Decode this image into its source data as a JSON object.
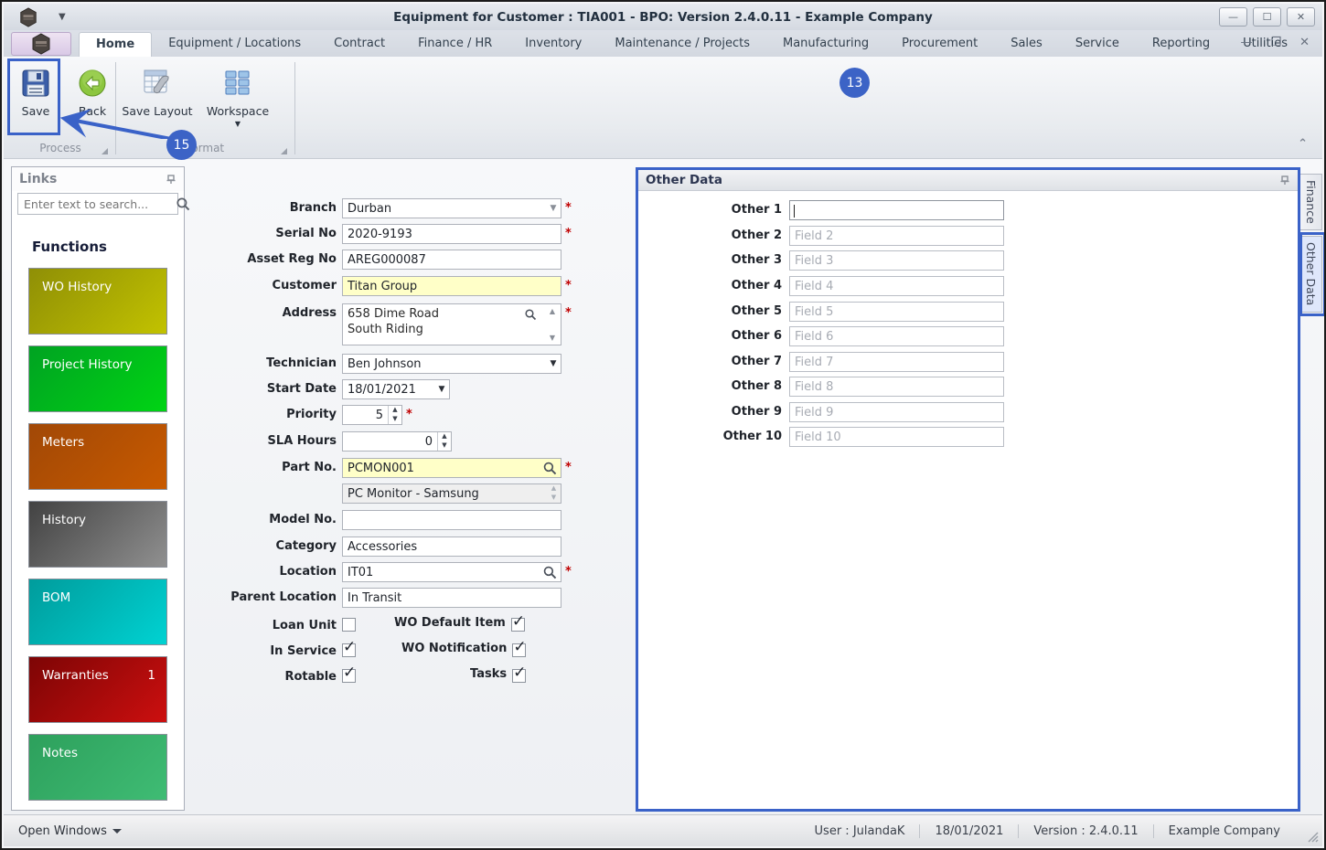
{
  "window": {
    "title": "Equipment for Customer : TIA001 - BPO: Version 2.4.0.11 - Example Company"
  },
  "ribbon": {
    "tabs": [
      {
        "label": "Home"
      },
      {
        "label": "Equipment / Locations"
      },
      {
        "label": "Contract"
      },
      {
        "label": "Finance / HR"
      },
      {
        "label": "Inventory"
      },
      {
        "label": "Maintenance / Projects"
      },
      {
        "label": "Manufacturing"
      },
      {
        "label": "Procurement"
      },
      {
        "label": "Sales"
      },
      {
        "label": "Service"
      },
      {
        "label": "Reporting"
      },
      {
        "label": "Utilities"
      }
    ],
    "actions": {
      "save": "Save",
      "back": "Back",
      "save_layout": "Save Layout",
      "workspace": "Workspace"
    },
    "groups": {
      "process": "Process",
      "format": "Format"
    }
  },
  "links": {
    "title": "Links",
    "search_placeholder": "Enter text to search...",
    "heading": "Functions",
    "buttons": [
      {
        "label": "WO History",
        "badge": "",
        "c1": "#8f8f06",
        "c2": "#c2c200"
      },
      {
        "label": "Project History",
        "badge": "",
        "c1": "#00a322",
        "c2": "#00d414"
      },
      {
        "label": "Meters",
        "badge": "",
        "c1": "#a14806",
        "c2": "#c85a00"
      },
      {
        "label": "History",
        "badge": "",
        "c1": "#424242",
        "c2": "#909090"
      },
      {
        "label": "BOM",
        "badge": "",
        "c1": "#009c9c",
        "c2": "#00d2d2"
      },
      {
        "label": "Warranties",
        "badge": "1",
        "c1": "#7d0505",
        "c2": "#cc0f0f"
      },
      {
        "label": "Notes",
        "badge": "",
        "c1": "#2da05c",
        "c2": "#3fbc74"
      }
    ]
  },
  "form": {
    "branch": {
      "label": "Branch",
      "value": "Durban",
      "req": "*"
    },
    "serial": {
      "label": "Serial No",
      "value": "2020-9193",
      "req": "*"
    },
    "asset": {
      "label": "Asset Reg No",
      "value": "AREG000087"
    },
    "customer": {
      "label": "Customer",
      "value": "Titan Group",
      "req": "*"
    },
    "address": {
      "label": "Address",
      "line1": "658 Dime Road",
      "line2": "South Riding",
      "req": "*"
    },
    "technician": {
      "label": "Technician",
      "value": "Ben Johnson"
    },
    "start_date": {
      "label": "Start Date",
      "value": "18/01/2021"
    },
    "priority": {
      "label": "Priority",
      "value": "5",
      "req": "*"
    },
    "sla": {
      "label": "SLA Hours",
      "value": "0"
    },
    "part": {
      "label": "Part No.",
      "value": "PCMON001",
      "req": "*"
    },
    "part_desc": {
      "value": "PC Monitor - Samsung"
    },
    "model": {
      "label": "Model No.",
      "value": ""
    },
    "category": {
      "label": "Category",
      "value": "Accessories"
    },
    "location": {
      "label": "Location",
      "value": "IT01",
      "req": "*"
    },
    "parent_location": {
      "label": "Parent Location",
      "value": "In Transit"
    },
    "checks": [
      {
        "label": "Loan Unit",
        "checked": false
      },
      {
        "label": "WO Default Item",
        "checked": true
      },
      {
        "label": "In Service",
        "checked": true
      },
      {
        "label": "WO Notification",
        "checked": true
      },
      {
        "label": "Rotable",
        "checked": true
      },
      {
        "label": "Tasks",
        "checked": true
      }
    ]
  },
  "other_data": {
    "title": "Other Data",
    "rows": [
      {
        "label": "Other 1",
        "value": "",
        "placeholder": ""
      },
      {
        "label": "Other 2",
        "value": "",
        "placeholder": "Field 2"
      },
      {
        "label": "Other 3",
        "value": "",
        "placeholder": "Field 3"
      },
      {
        "label": "Other 4",
        "value": "",
        "placeholder": "Field 4"
      },
      {
        "label": "Other 5",
        "value": "",
        "placeholder": "Field 5"
      },
      {
        "label": "Other 6",
        "value": "",
        "placeholder": "Field 6"
      },
      {
        "label": "Other 7",
        "value": "",
        "placeholder": "Field 7"
      },
      {
        "label": "Other 8",
        "value": "",
        "placeholder": "Field 8"
      },
      {
        "label": "Other 9",
        "value": "",
        "placeholder": "Field 9"
      },
      {
        "label": "Other 10",
        "value": "",
        "placeholder": "Field 10"
      }
    ]
  },
  "side_tabs": [
    {
      "label": "Finance"
    },
    {
      "label": "Other Data"
    }
  ],
  "status": {
    "open_windows": "Open Windows",
    "user": "User : JulandaK",
    "date": "18/01/2021",
    "version": "Version : 2.4.0.11",
    "company": "Example Company"
  },
  "annotations": {
    "balloon_13": "13",
    "balloon_15": "15",
    "accent": "#3a62c8"
  }
}
